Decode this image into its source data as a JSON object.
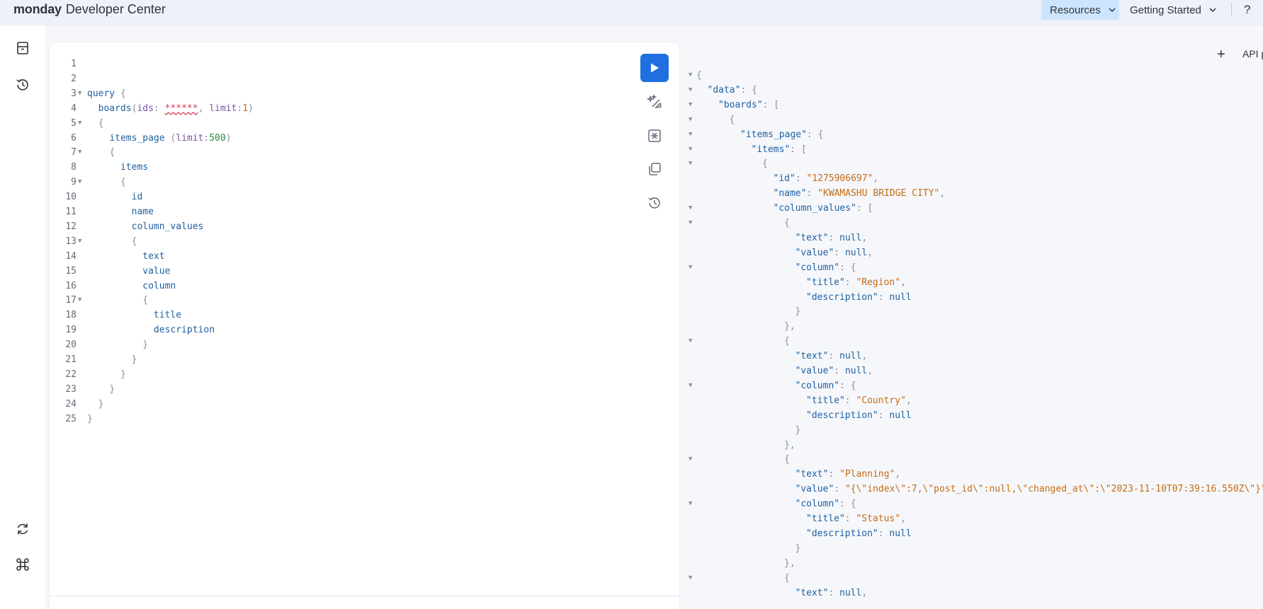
{
  "header": {
    "brand_bold": "monday",
    "brand_rest": "Developer Center",
    "nav_resources": "Resources",
    "nav_getting_started": "Getting Started",
    "help": "?"
  },
  "rail": {
    "top_icons": [
      "archive-icon",
      "history-icon"
    ],
    "bottom_icons": [
      "refresh-icon",
      "command-icon"
    ]
  },
  "editor": {
    "lines": [
      {
        "n": "1",
        "t": ""
      },
      {
        "n": "2",
        "t": ""
      },
      {
        "n": "3",
        "t": "query {"
      },
      {
        "n": "4",
        "t": "  boards(ids: ******, limit:1)"
      },
      {
        "n": "5",
        "t": "  {"
      },
      {
        "n": "6",
        "t": "    items_page (limit:500)"
      },
      {
        "n": "7",
        "t": "    {"
      },
      {
        "n": "8",
        "t": "      items"
      },
      {
        "n": "9",
        "t": "      {"
      },
      {
        "n": "10",
        "t": "        id"
      },
      {
        "n": "11",
        "t": "        name"
      },
      {
        "n": "12",
        "t": "        column_values"
      },
      {
        "n": "13",
        "t": "        {"
      },
      {
        "n": "14",
        "t": "          text"
      },
      {
        "n": "15",
        "t": "          value"
      },
      {
        "n": "16",
        "t": "          column"
      },
      {
        "n": "17",
        "t": "          {"
      },
      {
        "n": "18",
        "t": "            title"
      },
      {
        "n": "19",
        "t": "            description"
      },
      {
        "n": "20",
        "t": "          }"
      },
      {
        "n": "21",
        "t": "        }"
      },
      {
        "n": "22",
        "t": "      }"
      },
      {
        "n": "23",
        "t": "    }"
      },
      {
        "n": "24",
        "t": "  }"
      },
      {
        "n": "25",
        "t": "}"
      }
    ],
    "fold_lines": [
      "3",
      "5",
      "7",
      "9",
      "13",
      "17"
    ],
    "toolbar": [
      "run-button",
      "prettify-icon",
      "merge-icon",
      "copy-icon",
      "history-icon"
    ]
  },
  "result": {
    "tab_label": "API p",
    "add_tab": "+",
    "lines": [
      {
        "i": 0,
        "f": true,
        "p": [
          "{"
        ]
      },
      {
        "i": 1,
        "f": true,
        "p": [
          "\"data\"",
          ": {"
        ]
      },
      {
        "i": 2,
        "f": true,
        "p": [
          "\"boards\"",
          ": ["
        ]
      },
      {
        "i": 3,
        "f": true,
        "p": [
          "{"
        ]
      },
      {
        "i": 4,
        "f": true,
        "p": [
          "\"items_page\"",
          ": {"
        ]
      },
      {
        "i": 5,
        "f": true,
        "p": [
          "\"items\"",
          ": ["
        ]
      },
      {
        "i": 6,
        "f": true,
        "p": [
          "{"
        ]
      },
      {
        "i": 7,
        "f": false,
        "p": [
          "\"id\"",
          ": ",
          "\"1275906697\"",
          ","
        ]
      },
      {
        "i": 7,
        "f": false,
        "p": [
          "\"name\"",
          ": ",
          "\"KWAMASHU BRIDGE CITY\"",
          ","
        ]
      },
      {
        "i": 7,
        "f": true,
        "p": [
          "\"column_values\"",
          ": ["
        ]
      },
      {
        "i": 8,
        "f": true,
        "p": [
          "{"
        ]
      },
      {
        "i": 9,
        "f": false,
        "p": [
          "\"text\"",
          ": ",
          "null",
          ","
        ]
      },
      {
        "i": 9,
        "f": false,
        "p": [
          "\"value\"",
          ": ",
          "null",
          ","
        ]
      },
      {
        "i": 9,
        "f": true,
        "p": [
          "\"column\"",
          ": {"
        ]
      },
      {
        "i": 10,
        "f": false,
        "p": [
          "\"title\"",
          ": ",
          "\"Region\"",
          ","
        ]
      },
      {
        "i": 10,
        "f": false,
        "p": [
          "\"description\"",
          ": ",
          "null"
        ]
      },
      {
        "i": 9,
        "f": false,
        "p": [
          "}"
        ]
      },
      {
        "i": 8,
        "f": false,
        "p": [
          "},"
        ]
      },
      {
        "i": 8,
        "f": true,
        "p": [
          "{"
        ]
      },
      {
        "i": 9,
        "f": false,
        "p": [
          "\"text\"",
          ": ",
          "null",
          ","
        ]
      },
      {
        "i": 9,
        "f": false,
        "p": [
          "\"value\"",
          ": ",
          "null",
          ","
        ]
      },
      {
        "i": 9,
        "f": true,
        "p": [
          "\"column\"",
          ": {"
        ]
      },
      {
        "i": 10,
        "f": false,
        "p": [
          "\"title\"",
          ": ",
          "\"Country\"",
          ","
        ]
      },
      {
        "i": 10,
        "f": false,
        "p": [
          "\"description\"",
          ": ",
          "null"
        ]
      },
      {
        "i": 9,
        "f": false,
        "p": [
          "}"
        ]
      },
      {
        "i": 8,
        "f": false,
        "p": [
          "},"
        ]
      },
      {
        "i": 8,
        "f": true,
        "p": [
          "{"
        ]
      },
      {
        "i": 9,
        "f": false,
        "p": [
          "\"text\"",
          ": ",
          "\"Planning\"",
          ","
        ]
      },
      {
        "i": 9,
        "f": false,
        "p": [
          "\"value\"",
          ": ",
          "\"{\\\"index\\\":7,\\\"post_id\\\":null,\\\"changed_at\\\":\\\"2023-11-10T07:39:16.550Z\\\"}\"",
          ","
        ]
      },
      {
        "i": 9,
        "f": true,
        "p": [
          "\"column\"",
          ": {"
        ]
      },
      {
        "i": 10,
        "f": false,
        "p": [
          "\"title\"",
          ": ",
          "\"Status\"",
          ","
        ]
      },
      {
        "i": 10,
        "f": false,
        "p": [
          "\"description\"",
          ": ",
          "null"
        ]
      },
      {
        "i": 9,
        "f": false,
        "p": [
          "}"
        ]
      },
      {
        "i": 8,
        "f": false,
        "p": [
          "},"
        ]
      },
      {
        "i": 8,
        "f": true,
        "p": [
          "{"
        ]
      },
      {
        "i": 9,
        "f": false,
        "p": [
          "\"text\"",
          ": ",
          "null",
          ","
        ]
      }
    ]
  },
  "colors": {
    "run_button": "#1f6fe0",
    "header_bg": "#eef1f9",
    "resources_bg": "#cce5ff",
    "key": "#1f61a0",
    "string": "#c46c14"
  }
}
